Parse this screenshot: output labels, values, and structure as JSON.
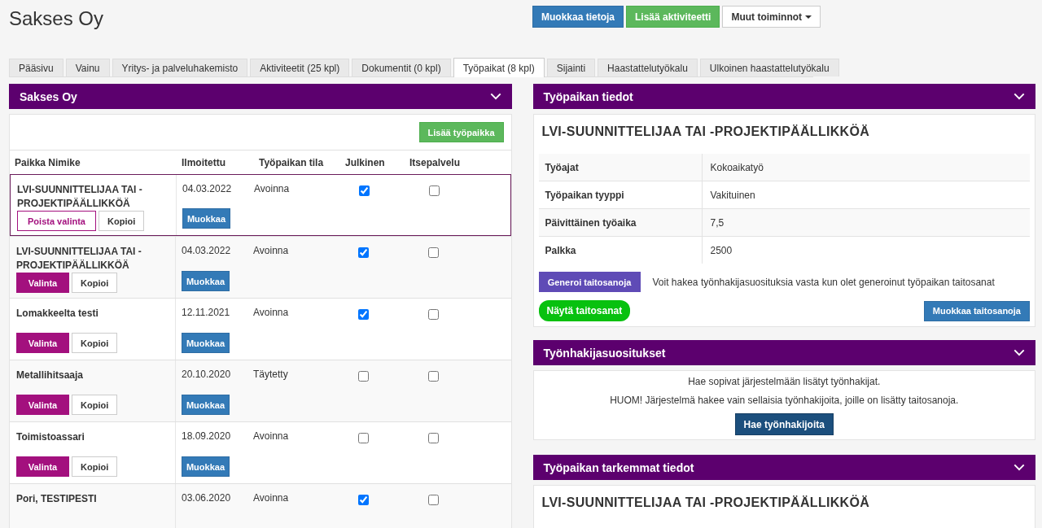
{
  "company_title": "Sakses Oy",
  "header_buttons": [
    {
      "label": "Muokkaa tietoja",
      "kind": "primary"
    },
    {
      "label": "Lisää aktiviteetti",
      "kind": "success"
    },
    {
      "label": "Muut toiminnot",
      "kind": "dropdown"
    }
  ],
  "tabs": [
    {
      "label": "Pääsivu",
      "selected": false
    },
    {
      "label": "Vainu",
      "selected": false
    },
    {
      "label": "Yritys- ja palveluhakemisto",
      "selected": false
    },
    {
      "label": "Aktiviteetit (25 kpl)",
      "selected": false
    },
    {
      "label": "Dokumentit (0 kpl)",
      "selected": false
    },
    {
      "label": "Työpaikat (8 kpl)",
      "selected": true
    },
    {
      "label": "Sijainti",
      "selected": false
    },
    {
      "label": "Haastattelutyökalu",
      "selected": false
    },
    {
      "label": "Ulkoinen haastattelutyökalu",
      "selected": false
    }
  ],
  "jobs_panel": {
    "title": "Sakses Oy",
    "add_button": "Lisää työpaikka",
    "columns": [
      "Paikka Nimike",
      "Ilmoitettu",
      "Työpaikan tila",
      "Julkinen",
      "Itsepalvelu"
    ],
    "rows": [
      {
        "title": "LVI-SUUNNITTELIJAA TAI -PROJEKTIPÄÄLLIKKÖÄ",
        "date": "04.03.2022",
        "status": "Avoinna",
        "public": true,
        "self_service": false,
        "selected": true,
        "select_button": "Poista valinta",
        "copy_button": "Kopioi",
        "edit_button": "Muokkaa"
      },
      {
        "title": "LVI-SUUNNITTELIJAA TAI -PROJEKTIPÄÄLLIKKÖÄ",
        "date": "04.03.2022",
        "status": "Avoinna",
        "public": true,
        "self_service": false,
        "selected": false,
        "select_button": "Valinta",
        "copy_button": "Kopioi",
        "edit_button": "Muokkaa"
      },
      {
        "title": "Lomakkeelta testi",
        "date": "12.11.2021",
        "status": "Avoinna",
        "public": true,
        "self_service": false,
        "selected": false,
        "select_button": "Valinta",
        "copy_button": "Kopioi",
        "edit_button": "Muokkaa"
      },
      {
        "title": "Metallihitsaaja",
        "date": "20.10.2020",
        "status": "Täytetty",
        "public": false,
        "self_service": false,
        "selected": false,
        "select_button": "Valinta",
        "copy_button": "Kopioi",
        "edit_button": "Muokkaa"
      },
      {
        "title": "Toimistoassari",
        "date": "18.09.2020",
        "status": "Avoinna",
        "public": false,
        "self_service": false,
        "selected": false,
        "select_button": "Valinta",
        "copy_button": "Kopioi",
        "edit_button": "Muokkaa"
      },
      {
        "title": "Pori, TESTIPESTI",
        "date": "03.06.2020",
        "status": "Avoinna",
        "public": true,
        "self_service": false,
        "selected": false
      }
    ]
  },
  "details_panel": {
    "title": "Työpaikan tiedot",
    "job_title": "LVI-SUUNNITTELIJAA TAI -PROJEKTIPÄÄLLIKKÖÄ",
    "fields": [
      {
        "label": "Työajat",
        "value": "Kokoaikatyö"
      },
      {
        "label": "Työpaikan tyyppi",
        "value": "Vakituinen"
      },
      {
        "label": "Päivittäinen työaika",
        "value": "7,5"
      },
      {
        "label": "Palkka",
        "value": "2500"
      }
    ],
    "generate_button": "Generoi taitosanoja",
    "generate_note": "Voit hakea työnhakijasuosituksia vasta kun olet generoinut työpaikan taitosanat",
    "show_button": "Näytä taitosanat",
    "edit_button": "Muokkaa taitosanoja"
  },
  "recommendations_panel": {
    "title": "Työnhakijasuositukset",
    "lines": [
      "Hae sopivat järjestelmään lisätyt työnhakijat.",
      "HUOM! Järjestelmä hakee vain sellaisia työnhakijoita, joille on lisätty taitosanoja."
    ],
    "search_button": "Hae työnhakijoita"
  },
  "more_details_panel": {
    "title": "Työpaikan tarkemmat tiedot",
    "job_title": "LVI-SUUNNITTELIJAA TAI -PROJEKTIPÄÄLLIKKÖÄ"
  }
}
